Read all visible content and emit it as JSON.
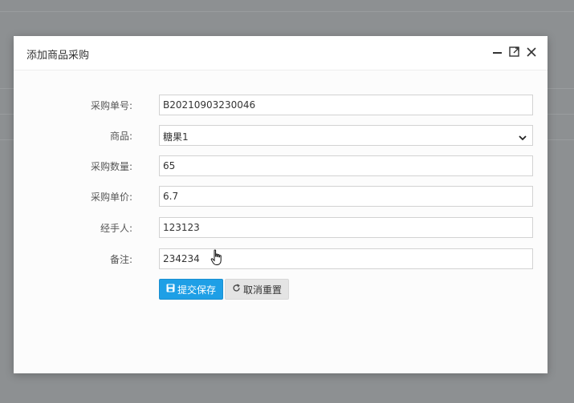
{
  "dialog": {
    "title": "添加商品采购"
  },
  "form": {
    "fields": [
      {
        "label": "采购单号:",
        "value": "B20210903230046"
      },
      {
        "label": "商品:",
        "value": "糖果1"
      },
      {
        "label": "采购数量:",
        "value": "65"
      },
      {
        "label": "采购单价:",
        "value": "6.7"
      },
      {
        "label": "经手人:",
        "value": "123123"
      },
      {
        "label": "备注:",
        "value": "234234"
      }
    ]
  },
  "buttons": {
    "submit_label": "提交保存",
    "reset_label": "取消重置"
  },
  "icons": {
    "minimize": "minimize-icon",
    "maximize": "maximize-icon",
    "close": "close-icon",
    "save": "save-icon",
    "refresh": "refresh-icon",
    "chevron": "chevron-down-icon",
    "cursor": "hand-cursor-icon"
  },
  "colors": {
    "primary": "#1e9fe6",
    "secondary": "#e4e4e4",
    "backdrop": "#8d9092"
  }
}
